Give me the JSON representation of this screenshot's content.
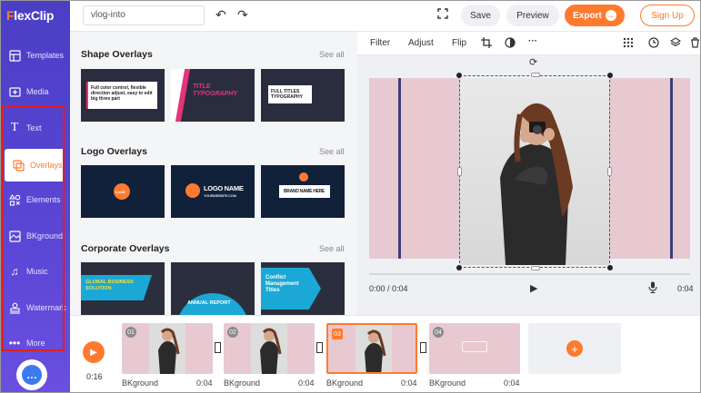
{
  "app": {
    "logo": "FlexClip",
    "logo_first": "F",
    "logo_rest": "lexClip"
  },
  "topbar": {
    "project_title": "vlog-into",
    "save_label": "Save",
    "preview_label": "Preview",
    "export_label": "Export",
    "signup_label": "Sign Up"
  },
  "sidebar": {
    "items": [
      {
        "label": "Templates",
        "icon": "templates-icon"
      },
      {
        "label": "Media",
        "icon": "media-icon"
      },
      {
        "label": "Text",
        "icon": "text-icon"
      },
      {
        "label": "Overlays",
        "icon": "overlays-icon",
        "active": true
      },
      {
        "label": "Elements",
        "icon": "elements-icon"
      },
      {
        "label": "BKground",
        "icon": "background-icon"
      },
      {
        "label": "Music",
        "icon": "music-icon"
      },
      {
        "label": "Watermark",
        "icon": "watermark-icon"
      },
      {
        "label": "More",
        "icon": "more-icon"
      }
    ]
  },
  "panel": {
    "sections": [
      {
        "title": "Shape Overlays",
        "see_all": "See all",
        "thumbs": [
          "Full color control, flexible direction adjust, easy to edit big three part",
          "TITLE TYPOGRAPHY",
          "FULL TITLES TYPOGRAPHY"
        ]
      },
      {
        "title": "Logo Overlays",
        "see_all": "See all",
        "thumbs": [
          "LOGO",
          "LOGO NAME",
          "BRAND NAME HERE"
        ]
      },
      {
        "title": "Corporate Overlays",
        "see_all": "See all",
        "thumbs": [
          "GLOBAL BUSINESS SOLUTION",
          "ANNUAL REPORT",
          "Conflict Management Titles"
        ]
      }
    ],
    "logo_sub": "YOURWEBSITE.COM"
  },
  "edit_toolbar": {
    "filter": "Filter",
    "adjust": "Adjust",
    "flip": "Flip"
  },
  "player": {
    "current": "0:00 / 0:04",
    "total": "0:04"
  },
  "timeline": {
    "total_time": "0:16",
    "clips": [
      {
        "num": "01",
        "label": "BKground",
        "duration": "0:04"
      },
      {
        "num": "02",
        "label": "BKground",
        "duration": "0:04"
      },
      {
        "num": "03",
        "label": "BKground",
        "duration": "0:04",
        "selected": true
      },
      {
        "num": "04",
        "label": "BKground",
        "duration": "0:04"
      }
    ]
  },
  "colors": {
    "accent": "#ff7a2f",
    "sidebar": "#5b46d6",
    "stage": "#e8c9d1",
    "highlight_box": "#e02020"
  }
}
